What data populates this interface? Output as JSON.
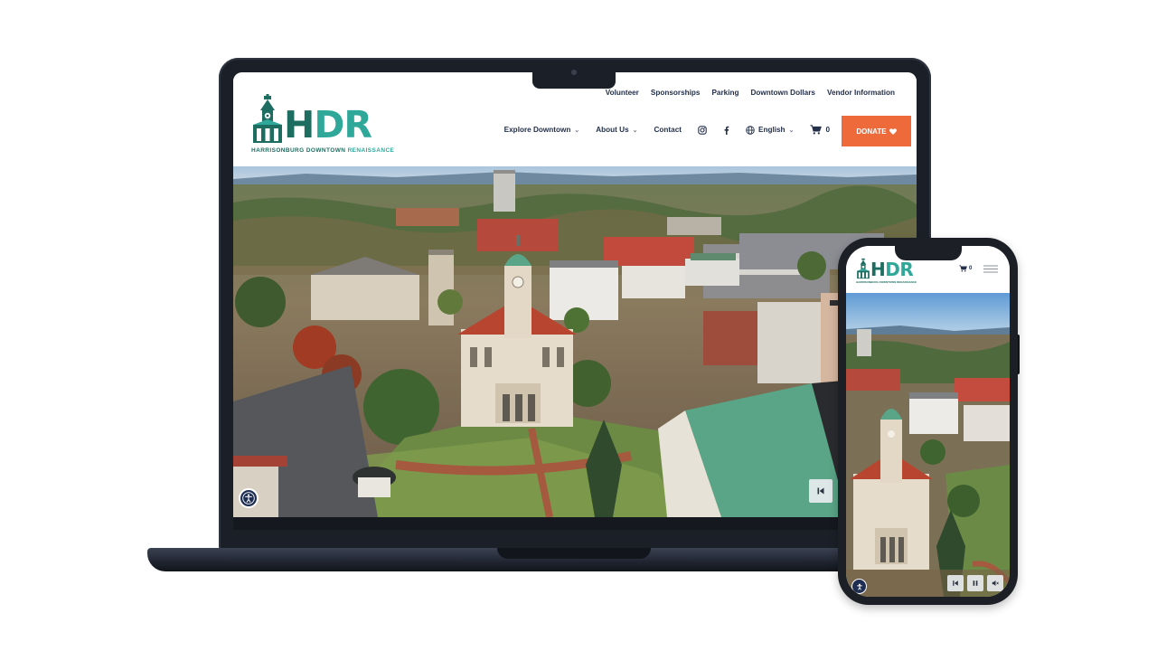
{
  "desktop": {
    "logo": {
      "letters_dark": "H",
      "letters_light": "DR",
      "tagline_dark": "HARRISONBURG DOWNTOWN",
      "tagline_light": "RENAISSANCE"
    },
    "utility_nav": [
      "Volunteer",
      "Sponsorships",
      "Parking",
      "Downtown Dollars",
      "Vendor Information"
    ],
    "main_nav": {
      "explore": "Explore Downtown",
      "about": "About Us",
      "contact": "Contact",
      "language": "English",
      "cart_count": "0"
    },
    "donate_label": "DONATE",
    "hero_controls": {
      "skip_icon": "skip-back-icon",
      "accessibility_icon": "accessibility-icon"
    }
  },
  "mobile": {
    "logo": {
      "letters_dark": "H",
      "letters_light": "DR",
      "tagline": "HARRISONBURG DOWNTOWN RENAISSANCE"
    },
    "cart_count": "0",
    "hero_controls": [
      "skip-back-icon",
      "pause-icon",
      "mute-icon"
    ]
  },
  "colors": {
    "brand_dark": "#1d6d61",
    "brand_light": "#2fa89a",
    "donate": "#ef6a3a",
    "nav_text": "#24304a",
    "device_frame": "#1b1f27"
  }
}
